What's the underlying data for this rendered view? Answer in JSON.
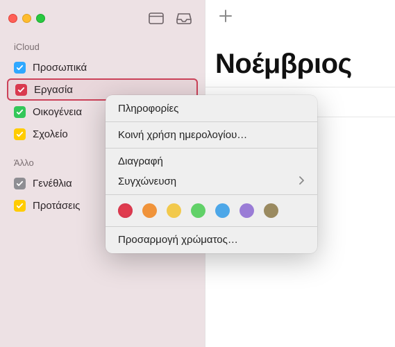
{
  "sidebar": {
    "sections": [
      {
        "title": "iCloud",
        "items": [
          {
            "label": "Προσωπικά",
            "color": "#2fa8ff",
            "selected": false
          },
          {
            "label": "Εργασία",
            "color": "#d93a4f",
            "selected": true
          },
          {
            "label": "Οικογένεια",
            "color": "#33c759",
            "selected": false
          },
          {
            "label": "Σχολείο",
            "color": "#ffcc00",
            "selected": false
          }
        ]
      },
      {
        "title": "Άλλο",
        "items": [
          {
            "label": "Γενέθλια",
            "color": "#8e8e93",
            "selected": false
          },
          {
            "label": "Προτάσεις",
            "color": "#ffcc00",
            "selected": false
          }
        ]
      }
    ]
  },
  "main": {
    "month_title": "Νοέμβριος"
  },
  "context_menu": {
    "info": "Πληροφορίες",
    "share": "Κοινή χρήση ημερολογίου…",
    "delete": "Διαγραφή",
    "merge": "Συγχώνευση",
    "custom_color": "Προσαρμογή χρώματος…",
    "colors": [
      {
        "name": "red",
        "hex": "#e03b4e",
        "selected": true
      },
      {
        "name": "orange",
        "hex": "#f0933a",
        "selected": false
      },
      {
        "name": "yellow",
        "hex": "#f2c94c",
        "selected": false
      },
      {
        "name": "green",
        "hex": "#61d168",
        "selected": false
      },
      {
        "name": "blue",
        "hex": "#4da7e8",
        "selected": false
      },
      {
        "name": "purple",
        "hex": "#9a7cd6",
        "selected": false
      },
      {
        "name": "brown",
        "hex": "#9a8a60",
        "selected": false
      }
    ]
  }
}
